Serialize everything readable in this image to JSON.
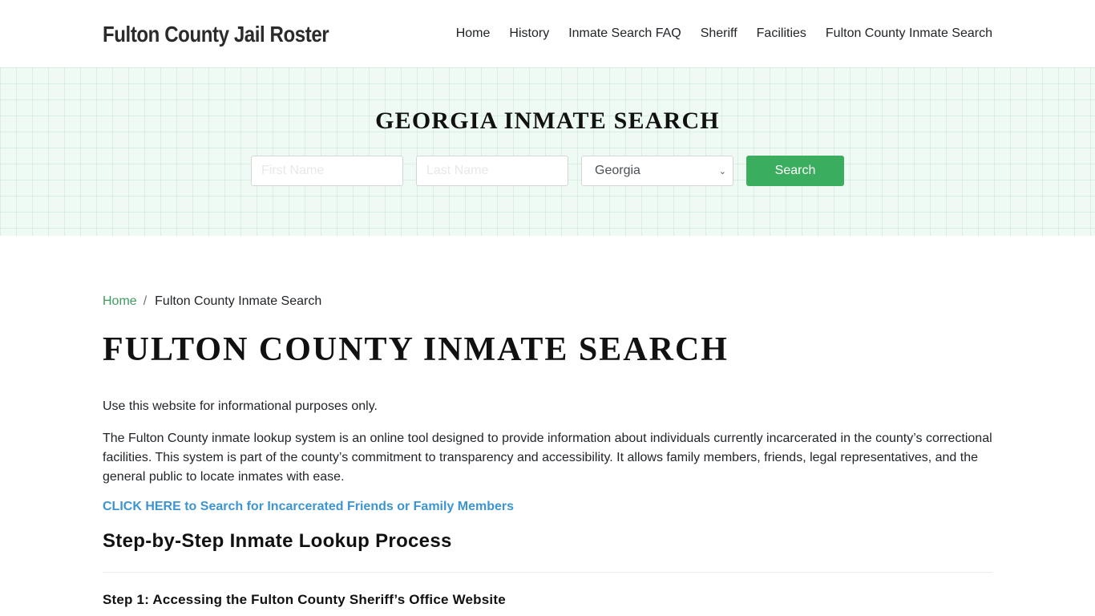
{
  "header": {
    "brand": "Fulton County Jail Roster",
    "nav": [
      {
        "label": "Home"
      },
      {
        "label": "History"
      },
      {
        "label": "Inmate Search FAQ"
      },
      {
        "label": "Sheriff"
      },
      {
        "label": "Facilities"
      },
      {
        "label": "Fulton County Inmate Search"
      }
    ]
  },
  "hero": {
    "title": "GEORGIA INMATE SEARCH",
    "first_name_placeholder": "First Name",
    "first_name_value": "",
    "last_name_placeholder": "Last Name",
    "last_name_value": "",
    "state_selected": "Georgia",
    "search_label": "Search",
    "accent_color": "#3aad5e"
  },
  "breadcrumb": {
    "home": "Home",
    "separator": "/",
    "current": "Fulton County Inmate Search"
  },
  "main": {
    "title": "FULTON COUNTY INMATE SEARCH",
    "disclaimer": "Use this website for informational purposes only.",
    "intro": "The Fulton County inmate lookup system is an online tool designed to provide information about individuals currently incarcerated in the county’s correctional facilities. This system is part of the county’s commitment to transparency and accessibility. It allows family members, friends, legal representatives, and the general public to locate inmates with ease.",
    "cta_link": "CLICK HERE to Search for Incarcerated Friends or Family Members",
    "section_title": "Step-by-Step Inmate Lookup Process",
    "step1_title": "Step 1: Accessing the Fulton County Sheriff’s Office Website"
  }
}
